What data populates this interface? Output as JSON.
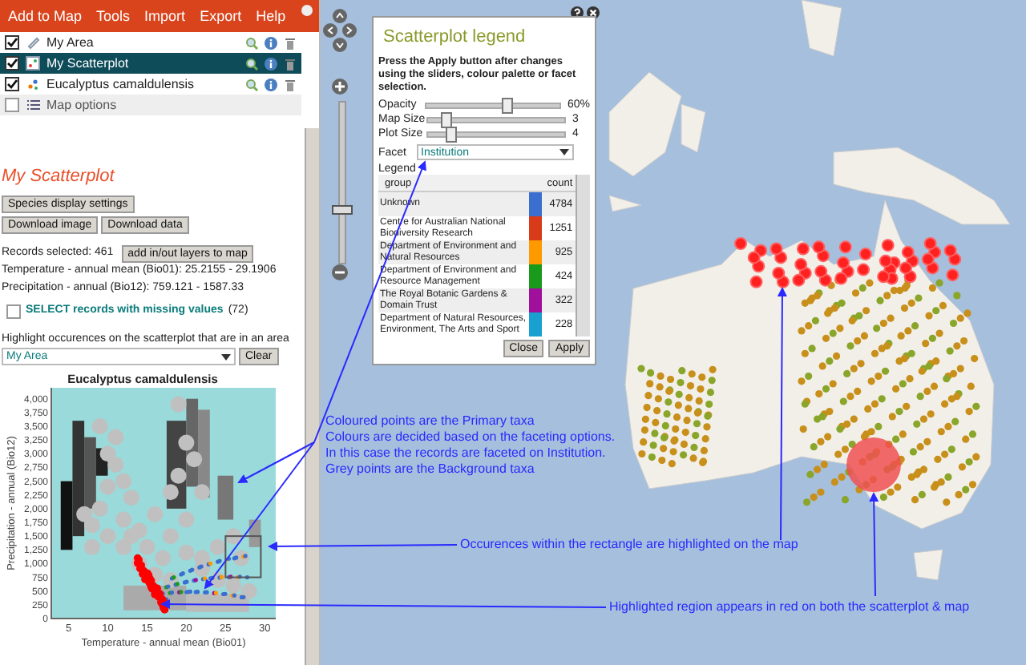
{
  "menu_bar": {
    "items": [
      "Add to Map",
      "Tools",
      "Import",
      "Export",
      "Help"
    ]
  },
  "layers": [
    {
      "kind": "area",
      "label": "My Area",
      "checked": true,
      "selected": false
    },
    {
      "kind": "scatterplot",
      "label": "My Scatterplot",
      "checked": true,
      "selected": true
    },
    {
      "kind": "species",
      "label": "Eucalyptus camaldulensis",
      "checked": true,
      "selected": false
    },
    {
      "kind": "options",
      "label": "Map options",
      "checked": false,
      "selected": false
    }
  ],
  "panel": {
    "title": "My Scatterplot",
    "button_rows": [
      [
        "Species display settings"
      ],
      [
        "Download image",
        "Download data"
      ]
    ],
    "records_selected": "Records selected: 461",
    "add_layers_button": "add in/out layers to map",
    "ranges": [
      "Temperature - annual mean (Bio01): 25.2155 - 29.1906",
      "Precipitation - annual (Bio12): 759.121 - 1587.33"
    ],
    "missing": {
      "checked": false,
      "label": "SELECT records with missing values",
      "count": "(72)"
    },
    "highlight_label": "Highlight occurences on the scatterplot that are in an area",
    "area_select": {
      "value": "My Area"
    },
    "clear_button": "Clear"
  },
  "scatterplot": {
    "title": "Eucalyptus camaldulensis",
    "xlabel": "Temperature - annual mean (Bio01)",
    "ylabel": "Precipitation - annual (Bio12)",
    "xticks": [
      "5",
      "10",
      "15",
      "20",
      "25",
      "30"
    ],
    "yticks": [
      "4,000",
      "3,750",
      "3,500",
      "3,250",
      "3,000",
      "2,750",
      "2,500",
      "2,250",
      "2,000",
      "1,750",
      "1,500",
      "1,250",
      "1,000",
      "750",
      "500",
      "250",
      "0"
    ]
  },
  "map": {
    "zoom": {
      "level": 0.34
    }
  },
  "legend_dialog": {
    "title": "Scatterplot legend",
    "instructions": "Press the Apply button after changes using the sliders, colour palette or facet selection.",
    "sliders": [
      {
        "label": "Opacity",
        "level": 0.6,
        "reading": "60%"
      },
      {
        "label": "Map Size",
        "level": 0.13,
        "reading": "3"
      },
      {
        "label": "Plot Size",
        "level": 0.17,
        "reading": "4"
      }
    ],
    "facet": {
      "label": "Facet",
      "value": "Institution"
    },
    "legend_label": "Legend",
    "columns": [
      "group",
      "count"
    ],
    "rows": [
      {
        "group": "Unknown",
        "color": "#3a6fd0",
        "count": "4784"
      },
      {
        "group": "Centre for Australian National Biodiversity Research",
        "color": "#d93a1a",
        "count": "1251"
      },
      {
        "group": "Department of Environment and Natural Resources",
        "color": "#ff9900",
        "count": "925"
      },
      {
        "group": "Department of Environment and Resource Management",
        "color": "#1a9a1a",
        "count": "424"
      },
      {
        "group": "The Royal Botanic Gardens & Domain Trust",
        "color": "#a0109a",
        "count": "322"
      },
      {
        "group": "Department of Natural Resources, Environment, The Arts and Sport",
        "color": "#1aa0d0",
        "count": "228"
      }
    ],
    "buttons": [
      "Close",
      "Apply"
    ]
  },
  "annotations": [
    {
      "lines": [
        "Coloured points are the Primary taxa",
        "Colours are decided based on the faceting options.",
        "In this case the records are faceted on Institution.",
        "Grey points are the Background taxa"
      ]
    },
    {
      "lines": [
        "Occurences within the rectangle are highlighted on the map"
      ]
    },
    {
      "lines": [
        "Highlighted region appears in red on both the scatterplot & map"
      ]
    }
  ]
}
